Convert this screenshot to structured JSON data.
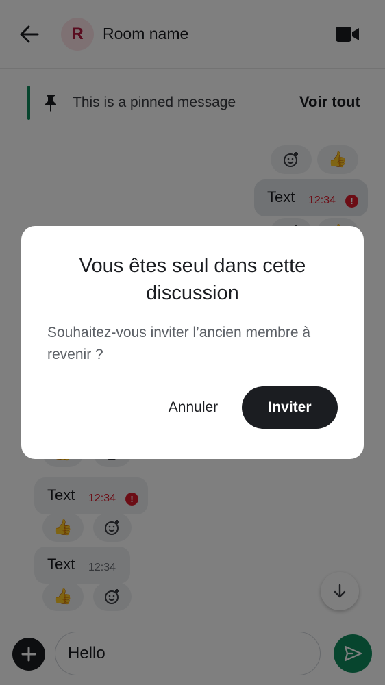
{
  "header": {
    "avatar_letter": "R",
    "room_name": "Room name"
  },
  "pinned": {
    "text": "This is a pinned message",
    "see_all_label": "Voir tout"
  },
  "timeline": {
    "messages": [
      {
        "text": "Text",
        "time": "12:34",
        "direction": "outgoing",
        "status": "error"
      },
      {
        "text": "Text",
        "time": "12:34",
        "direction": "incoming",
        "status": "error"
      },
      {
        "text": "Text",
        "time": "12:34",
        "direction": "incoming",
        "status": "sent"
      }
    ],
    "reaction_emoji": "👍"
  },
  "composer": {
    "input_value": "Hello"
  },
  "dialog": {
    "title": "Vous êtes seul dans cette discussion",
    "body": "Souhaitez-vous inviter l’ancien membre à revenir ?",
    "cancel_label": "Annuler",
    "invite_label": "Inviter"
  },
  "colors": {
    "accent": "#0e8a5c",
    "error": "#d91a2a",
    "avatar_bg": "#fde2e6",
    "avatar_fg": "#b2193f",
    "primary_button": "#1b1d21"
  },
  "icons": [
    "back-arrow-icon",
    "video-call-icon",
    "pin-icon",
    "add-reaction-icon",
    "error-icon",
    "arrow-down-icon",
    "plus-icon",
    "send-icon"
  ]
}
